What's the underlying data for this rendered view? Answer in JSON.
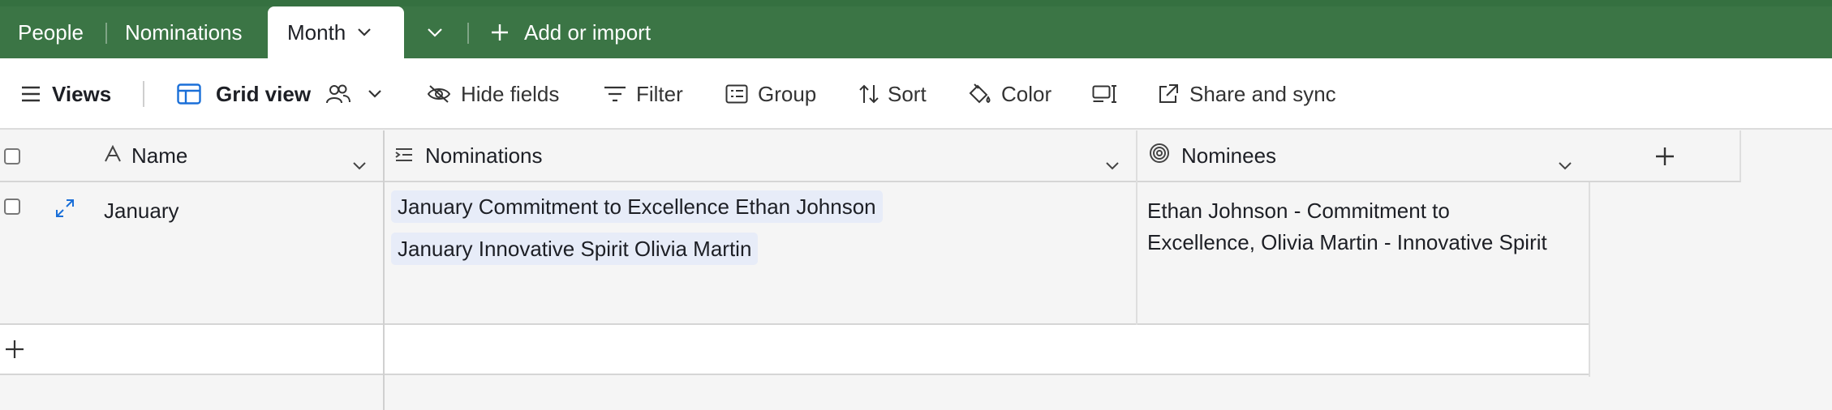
{
  "tabs": [
    {
      "label": "People"
    },
    {
      "label": "Nominations"
    },
    {
      "label": "Month",
      "active": true
    }
  ],
  "topbar": {
    "add_label": "Add or import"
  },
  "toolbar": {
    "views_label": "Views",
    "view_name": "Grid view",
    "hide_fields_label": "Hide fields",
    "filter_label": "Filter",
    "group_label": "Group",
    "sort_label": "Sort",
    "color_label": "Color",
    "share_label": "Share and sync"
  },
  "table": {
    "columns": [
      {
        "label": "Name",
        "icon": "text-a-icon"
      },
      {
        "label": "Nominations",
        "icon": "link-list-icon"
      },
      {
        "label": "Nominees",
        "icon": "rollup-spiral-icon"
      }
    ],
    "rows": [
      {
        "name": "January",
        "nominations": [
          "January Commitment to Excellence Ethan Johnson",
          "January Innovative Spirit Olivia Martin"
        ],
        "nominees_line1": "Ethan Johnson - Commitment to",
        "nominees_line2": "Excellence, Olivia Martin - Innovative Spirit"
      }
    ]
  },
  "colors": {
    "topbar": "#3b7545",
    "accent_blue": "#1a6fd8",
    "pill_bg": "#e7ecf8"
  }
}
